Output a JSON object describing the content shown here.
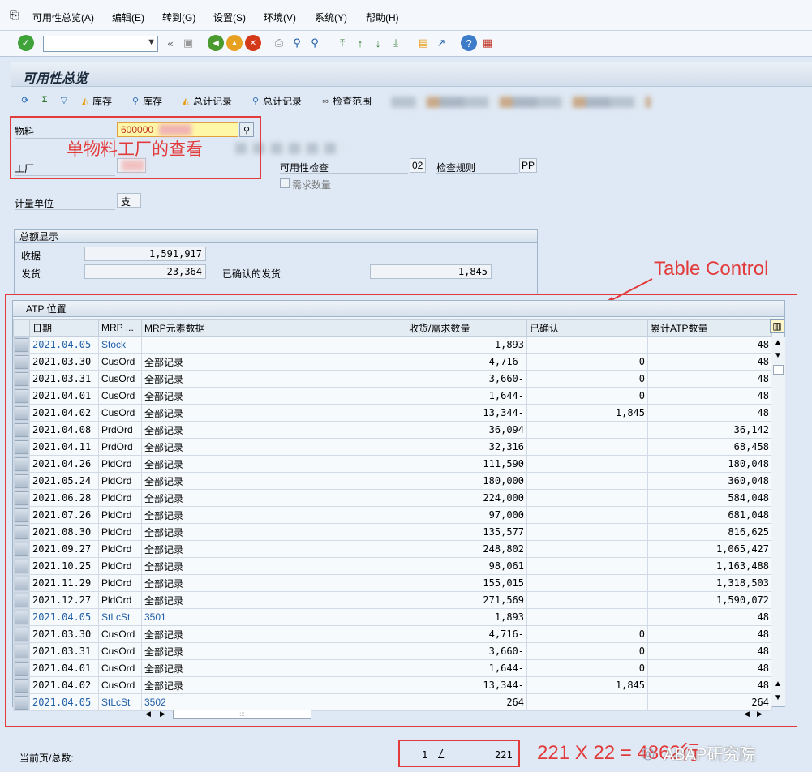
{
  "menu": {
    "items": [
      "可用性总览(A)",
      "编辑(E)",
      "转到(G)",
      "设置(S)",
      "环境(V)",
      "系统(Y)",
      "帮助(H)"
    ]
  },
  "toolbar": {
    "command_field": "",
    "icons": [
      "enter-icon",
      "save-icon",
      "back-icon",
      "exit-icon",
      "cancel-icon",
      "print-icon",
      "find-icon",
      "find-next-icon",
      "first-page-icon",
      "prev-page-icon",
      "next-page-icon",
      "last-page-icon",
      "new-session-icon",
      "shortcut-icon",
      "help-icon",
      "customize-icon"
    ]
  },
  "title": "可用性总览",
  "app_toolbar": {
    "buttons": [
      "库存",
      "库存",
      "总计记录",
      "总计记录",
      "检查范围"
    ]
  },
  "header": {
    "material_label": "物料",
    "material_value": "600000",
    "plant_label": "工厂",
    "plant_value": "",
    "uom_label": "计量单位",
    "uom_value": "支",
    "avail_check_label": "可用性检查",
    "avail_check_value": "02",
    "check_rule_label": "检查规则",
    "check_rule_value": "PP",
    "req_qty_label": "需求数量"
  },
  "annotations": {
    "single_material_plant": "单物料工厂的查看",
    "table_control": "Table Control",
    "calc": "221 X 22 = 4862行",
    "watermark": "ABAP研究院"
  },
  "totals": {
    "title": "总额显示",
    "receipt_label": "收据",
    "receipt_value": "1,591,917",
    "issue_label": "发货",
    "issue_value": "23,364",
    "confirmed_issue_label": "已确认的发货",
    "confirmed_issue_value": "1,845"
  },
  "atp": {
    "title": "ATP 位置",
    "columns": [
      "日期",
      "MRP ...",
      "MRP元素数据",
      "收货/需求数量",
      "已确认",
      "累计ATP数量"
    ],
    "rows": [
      {
        "date": "2021.04.05",
        "mrp": "Stock",
        "data": "",
        "qty": "1,893",
        "conf": "",
        "cum": "48",
        "hl": true
      },
      {
        "date": "2021.03.30",
        "mrp": "CusOrd",
        "data": "全部记录",
        "qty": "4,716-",
        "conf": "0",
        "cum": "48",
        "hl": false
      },
      {
        "date": "2021.03.31",
        "mrp": "CusOrd",
        "data": "全部记录",
        "qty": "3,660-",
        "conf": "0",
        "cum": "48",
        "hl": false
      },
      {
        "date": "2021.04.01",
        "mrp": "CusOrd",
        "data": "全部记录",
        "qty": "1,644-",
        "conf": "0",
        "cum": "48",
        "hl": false
      },
      {
        "date": "2021.04.02",
        "mrp": "CusOrd",
        "data": "全部记录",
        "qty": "13,344-",
        "conf": "1,845",
        "cum": "48",
        "hl": false
      },
      {
        "date": "2021.04.08",
        "mrp": "PrdOrd",
        "data": "全部记录",
        "qty": "36,094",
        "conf": "",
        "cum": "36,142",
        "hl": false
      },
      {
        "date": "2021.04.11",
        "mrp": "PrdOrd",
        "data": "全部记录",
        "qty": "32,316",
        "conf": "",
        "cum": "68,458",
        "hl": false
      },
      {
        "date": "2021.04.26",
        "mrp": "PldOrd",
        "data": "全部记录",
        "qty": "111,590",
        "conf": "",
        "cum": "180,048",
        "hl": false
      },
      {
        "date": "2021.05.24",
        "mrp": "PldOrd",
        "data": "全部记录",
        "qty": "180,000",
        "conf": "",
        "cum": "360,048",
        "hl": false
      },
      {
        "date": "2021.06.28",
        "mrp": "PldOrd",
        "data": "全部记录",
        "qty": "224,000",
        "conf": "",
        "cum": "584,048",
        "hl": false
      },
      {
        "date": "2021.07.26",
        "mrp": "PldOrd",
        "data": "全部记录",
        "qty": "97,000",
        "conf": "",
        "cum": "681,048",
        "hl": false
      },
      {
        "date": "2021.08.30",
        "mrp": "PldOrd",
        "data": "全部记录",
        "qty": "135,577",
        "conf": "",
        "cum": "816,625",
        "hl": false
      },
      {
        "date": "2021.09.27",
        "mrp": "PldOrd",
        "data": "全部记录",
        "qty": "248,802",
        "conf": "",
        "cum": "1,065,427",
        "hl": false
      },
      {
        "date": "2021.10.25",
        "mrp": "PldOrd",
        "data": "全部记录",
        "qty": "98,061",
        "conf": "",
        "cum": "1,163,488",
        "hl": false
      },
      {
        "date": "2021.11.29",
        "mrp": "PldOrd",
        "data": "全部记录",
        "qty": "155,015",
        "conf": "",
        "cum": "1,318,503",
        "hl": false
      },
      {
        "date": "2021.12.27",
        "mrp": "PldOrd",
        "data": "全部记录",
        "qty": "271,569",
        "conf": "",
        "cum": "1,590,072",
        "hl": false
      },
      {
        "date": "2021.04.05",
        "mrp": "StLcSt",
        "data": "3501",
        "qty": "1,893",
        "conf": "",
        "cum": "48",
        "hl": true
      },
      {
        "date": "2021.03.30",
        "mrp": "CusOrd",
        "data": "全部记录",
        "qty": "4,716-",
        "conf": "0",
        "cum": "48",
        "hl": false
      },
      {
        "date": "2021.03.31",
        "mrp": "CusOrd",
        "data": "全部记录",
        "qty": "3,660-",
        "conf": "0",
        "cum": "48",
        "hl": false
      },
      {
        "date": "2021.04.01",
        "mrp": "CusOrd",
        "data": "全部记录",
        "qty": "1,644-",
        "conf": "0",
        "cum": "48",
        "hl": false
      },
      {
        "date": "2021.04.02",
        "mrp": "CusOrd",
        "data": "全部记录",
        "qty": "13,344-",
        "conf": "1,845",
        "cum": "48",
        "hl": false
      },
      {
        "date": "2021.04.05",
        "mrp": "StLcSt",
        "data": "3502",
        "qty": "264",
        "conf": "",
        "cum": "264",
        "hl": true
      }
    ]
  },
  "footer": {
    "page_label": "当前页/总数:",
    "current_page": "1",
    "separator": "/",
    "total_pages": "221"
  }
}
